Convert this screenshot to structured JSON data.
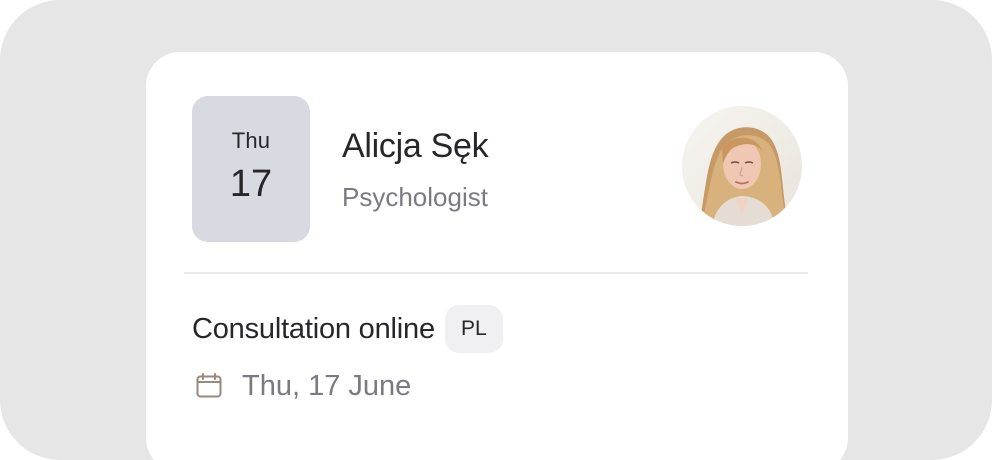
{
  "appointment": {
    "date_day": "Thu",
    "date_number": "17",
    "specialist_name": "Alicja Sęk",
    "specialist_role": "Psychologist",
    "consultation_title": "Consultation online",
    "language_badge": "PL",
    "consultation_date": "Thu, 17 June"
  },
  "icons": {
    "date": "calendar-icon",
    "avatar": "specialist-photo"
  },
  "colors": {
    "background": "#e6e6e7",
    "card": "#ffffff",
    "date_tile": "#d8dae1",
    "text_primary": "#27272a",
    "text_secondary": "#7a7a83",
    "badge": "#f0f0f2",
    "icon": "#9a877d"
  }
}
